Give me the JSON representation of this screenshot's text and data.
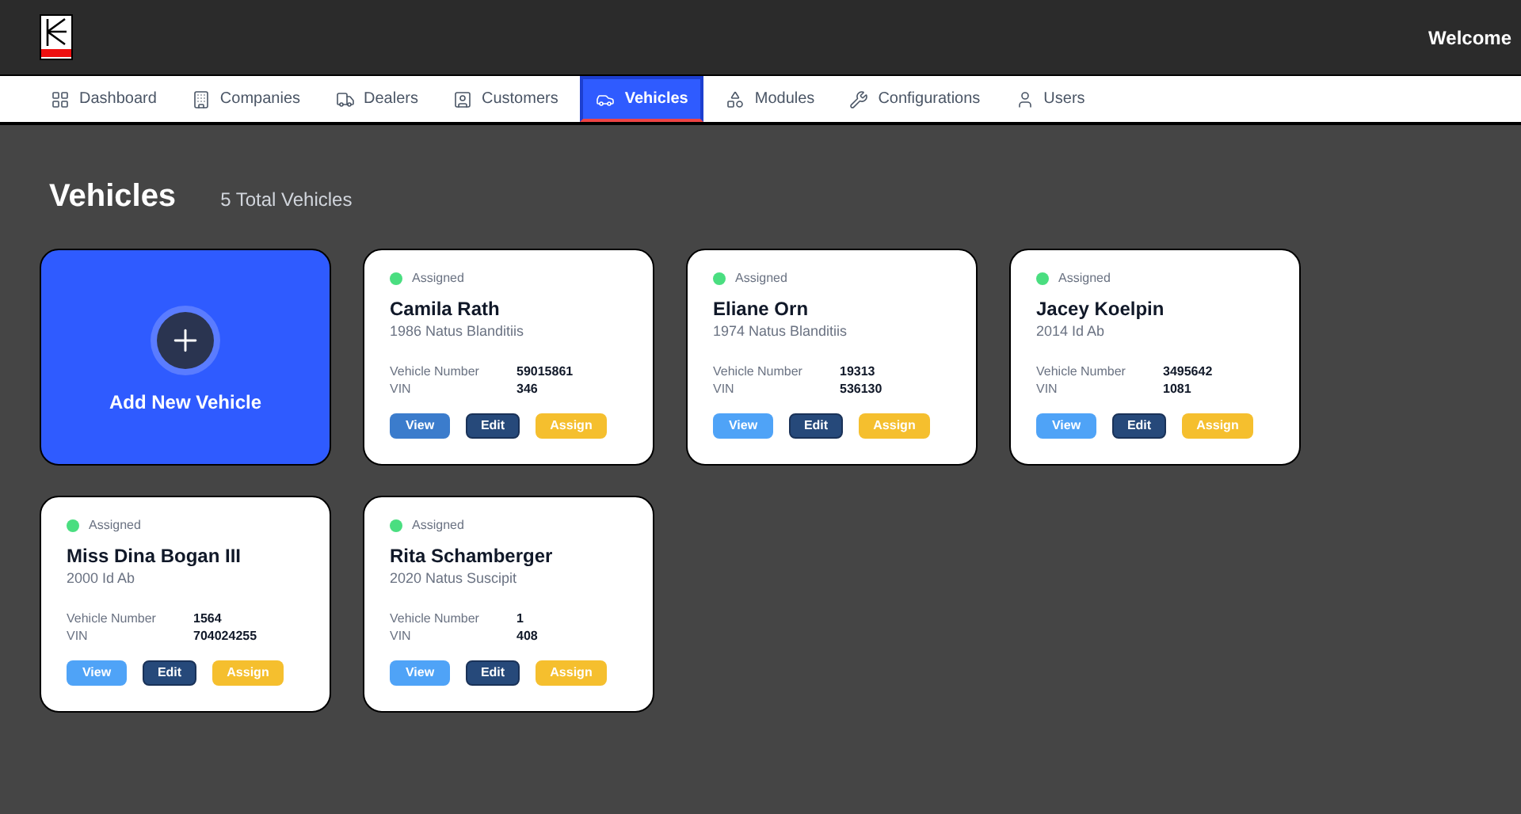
{
  "header": {
    "greeting": "Welcome"
  },
  "tabs": [
    {
      "label": "Dashboard",
      "selected": false
    },
    {
      "label": "Companies",
      "selected": false
    },
    {
      "label": "Dealers",
      "selected": false
    },
    {
      "label": "Customers",
      "selected": false
    },
    {
      "label": "Vehicles",
      "selected": true
    },
    {
      "label": "Modules",
      "selected": false
    },
    {
      "label": "Configurations",
      "selected": false
    },
    {
      "label": "Users",
      "selected": false
    }
  ],
  "page": {
    "title": "Vehicles",
    "count": "5 Total Vehicles"
  },
  "add_card": {
    "label": "Add New Vehicle"
  },
  "vehicles": [
    {
      "status": "Assigned",
      "color": "#4ade80",
      "name": "Camila Rath",
      "model": "1986 Natus Blanditiis",
      "number_label": "Vehicle Number",
      "number": "59015861",
      "vin_label": "VIN",
      "vin": "346",
      "view": "View",
      "view_highlighted": true,
      "edit": "Edit",
      "assign": "Assign"
    },
    {
      "status": "Assigned",
      "color": "#4ade80",
      "name": "Eliane Orn",
      "model": "1974 Natus Blanditiis",
      "number_label": "Vehicle Number",
      "number": "19313",
      "vin_label": "VIN",
      "vin": "536130",
      "view": "View",
      "view_highlighted": false,
      "edit": "Edit",
      "assign": "Assign"
    },
    {
      "status": "Assigned",
      "color": "#4ade80",
      "name": "Jacey Koelpin",
      "model": "2014 Id Ab",
      "number_label": "Vehicle Number",
      "number": "3495642",
      "vin_label": "VIN",
      "vin": "1081",
      "view": "View",
      "view_highlighted": false,
      "edit": "Edit",
      "assign": "Assign"
    },
    {
      "status": "Assigned",
      "color": "#4ade80",
      "name": "Miss Dina Bogan III",
      "model": "2000 Id Ab",
      "number_label": "Vehicle Number",
      "number": "1564",
      "vin_label": "VIN",
      "vin": "704024255",
      "view": "View",
      "view_highlighted": false,
      "edit": "Edit",
      "assign": "Assign"
    },
    {
      "status": "Assigned",
      "color": "#4ade80",
      "name": "Rita Schamberger",
      "model": "2020 Natus Suscipit",
      "number_label": "Vehicle Number",
      "number": "1",
      "vin_label": "VIN",
      "vin": "408",
      "view": "View",
      "view_highlighted": false,
      "edit": "Edit",
      "assign": "Assign"
    }
  ]
}
